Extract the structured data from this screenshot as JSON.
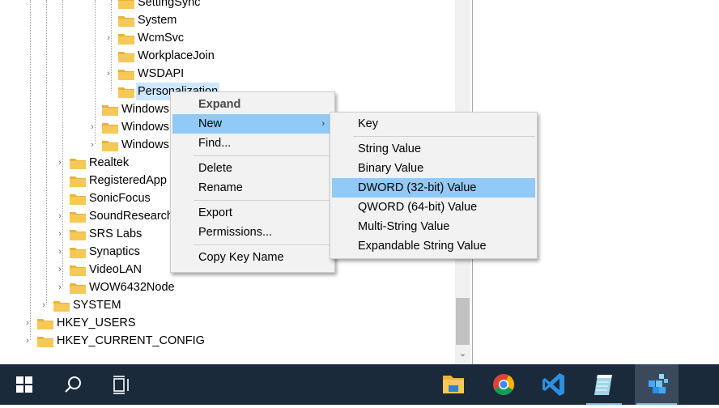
{
  "tree": {
    "items": [
      {
        "label": "SettingSync",
        "expander": ""
      },
      {
        "label": "System",
        "expander": ""
      },
      {
        "label": "WcmSvc",
        "expander": "›"
      },
      {
        "label": "WorkplaceJoin",
        "expander": ""
      },
      {
        "label": "WSDAPI",
        "expander": "›"
      },
      {
        "label": "Personalization",
        "expander": ""
      },
      {
        "label": "Windows",
        "expander": ""
      },
      {
        "label": "Windows",
        "expander": "›"
      },
      {
        "label": "Windows",
        "expander": "›"
      },
      {
        "label": "Realtek",
        "expander": "›"
      },
      {
        "label": "RegisteredApp",
        "expander": ""
      },
      {
        "label": "SonicFocus",
        "expander": ""
      },
      {
        "label": "SoundResearch",
        "expander": "›"
      },
      {
        "label": "SRS Labs",
        "expander": "›"
      },
      {
        "label": "Synaptics",
        "expander": "›"
      },
      {
        "label": "VideoLAN",
        "expander": "›"
      },
      {
        "label": "WOW6432Node",
        "expander": "›"
      },
      {
        "label": "SYSTEM",
        "expander": "›"
      },
      {
        "label": "HKEY_USERS",
        "expander": "›"
      },
      {
        "label": "HKEY_CURRENT_CONFIG",
        "expander": "›"
      }
    ]
  },
  "context_menu": {
    "items": [
      {
        "label": "Expand"
      },
      {
        "label": "New",
        "submenu_arrow": "›"
      },
      {
        "label": "Find..."
      },
      {
        "label": "Delete"
      },
      {
        "label": "Rename"
      },
      {
        "label": "Export"
      },
      {
        "label": "Permissions..."
      },
      {
        "label": "Copy Key Name"
      }
    ]
  },
  "new_submenu": {
    "items": [
      {
        "label": "Key"
      },
      {
        "label": "String Value"
      },
      {
        "label": "Binary Value"
      },
      {
        "label": "DWORD (32-bit) Value"
      },
      {
        "label": "QWORD (64-bit) Value"
      },
      {
        "label": "Multi-String Value"
      },
      {
        "label": "Expandable String Value"
      }
    ]
  },
  "taskbar": {
    "buttons": [
      "start-icon",
      "search-icon",
      "task-view-icon",
      "file-explorer-icon",
      "chrome-icon",
      "vscode-icon",
      "notepad-icon",
      "regedit-icon"
    ]
  },
  "colors": {
    "selection": "#cce8ff",
    "menu_highlight": "#91c9f7",
    "folder": "#f6c956",
    "taskbar": "#1b2a3a"
  }
}
